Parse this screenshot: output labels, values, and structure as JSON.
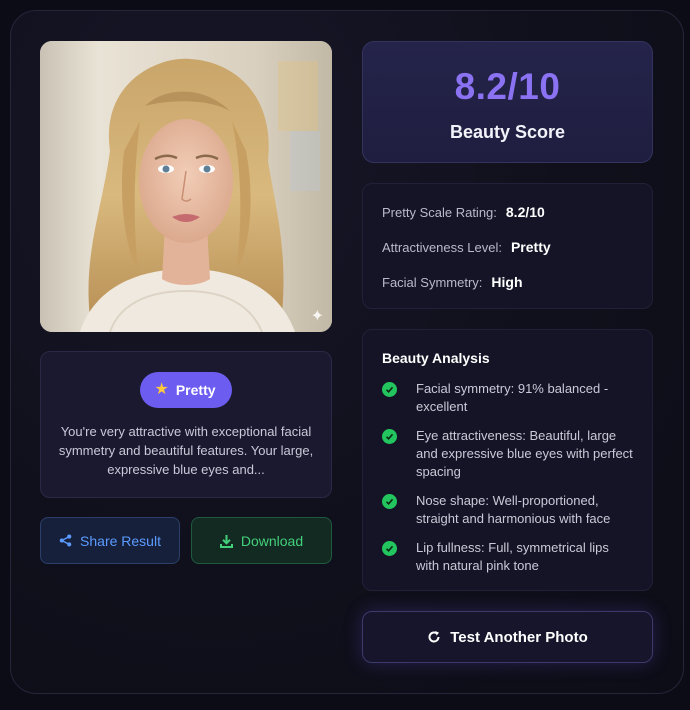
{
  "profile": {
    "badge_label": "Pretty",
    "badge_icon": "star-icon",
    "summary": "You're very attractive with exceptional facial symmetry and beautiful features. Your large, expressive blue eyes and..."
  },
  "actions": {
    "share_label": "Share Result",
    "share_icon": "share-icon",
    "download_label": "Download",
    "download_icon": "download-icon",
    "test_another_label": "Test Another Photo",
    "test_another_icon": "refresh-icon"
  },
  "score": {
    "value": "8.2/10",
    "label": "Beauty Score"
  },
  "ratings": [
    {
      "label": "Pretty Scale Rating:",
      "value": "8.2/10"
    },
    {
      "label": "Attractiveness Level:",
      "value": "Pretty"
    },
    {
      "label": "Facial Symmetry:",
      "value": "High"
    }
  ],
  "analysis": {
    "title": "Beauty Analysis",
    "items": [
      "Facial symmetry: 91% balanced - excellent",
      "Eye attractiveness: Beautiful, large and expressive blue eyes with perfect spacing",
      "Nose shape: Well-proportioned, straight and harmonious with face",
      "Lip fullness: Full, symmetrical lips with natural pink tone"
    ]
  },
  "colors": {
    "accent": "#6d5cf0",
    "score": "#8a72f2",
    "share": "#5b9bff",
    "download": "#43d07a",
    "check": "#22c55e"
  }
}
